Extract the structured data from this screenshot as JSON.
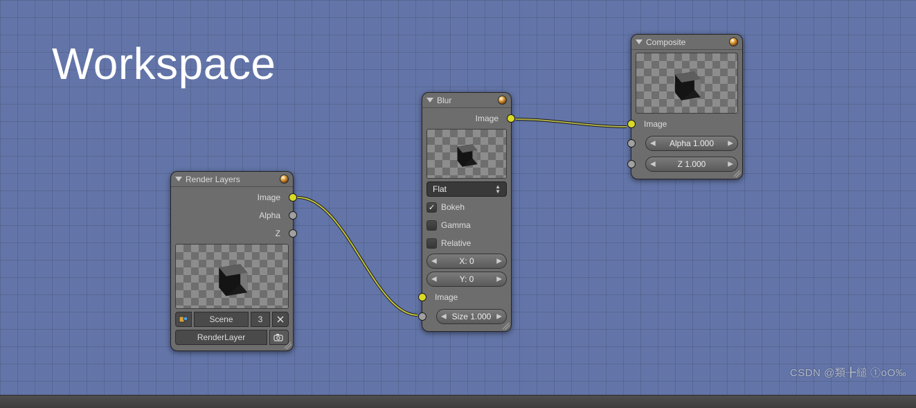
{
  "overlay_title": "Workspace",
  "watermark": "CSDN @類╊縋 ①oO‰",
  "nodes": {
    "render_layers": {
      "title": "Render Layers",
      "outputs": {
        "image": "Image",
        "alpha": "Alpha",
        "z": "Z"
      },
      "scene_picker": {
        "scene_label": "Scene",
        "count": "3"
      },
      "layer_picker": {
        "layer_label": "RenderLayer"
      }
    },
    "blur": {
      "title": "Blur",
      "outputs": {
        "image": "Image"
      },
      "falloff_select": "Flat",
      "check_bokeh": "Bokeh",
      "check_gamma": "Gamma",
      "check_relative": "Relative",
      "fields": {
        "x": "X: 0",
        "y": "Y: 0"
      },
      "inputs": {
        "image": "Image",
        "size": "Size 1.000"
      }
    },
    "composite": {
      "title": "Composite",
      "inputs": {
        "image": "Image",
        "alpha": "Alpha 1.000",
        "z": "Z 1.000"
      }
    }
  }
}
